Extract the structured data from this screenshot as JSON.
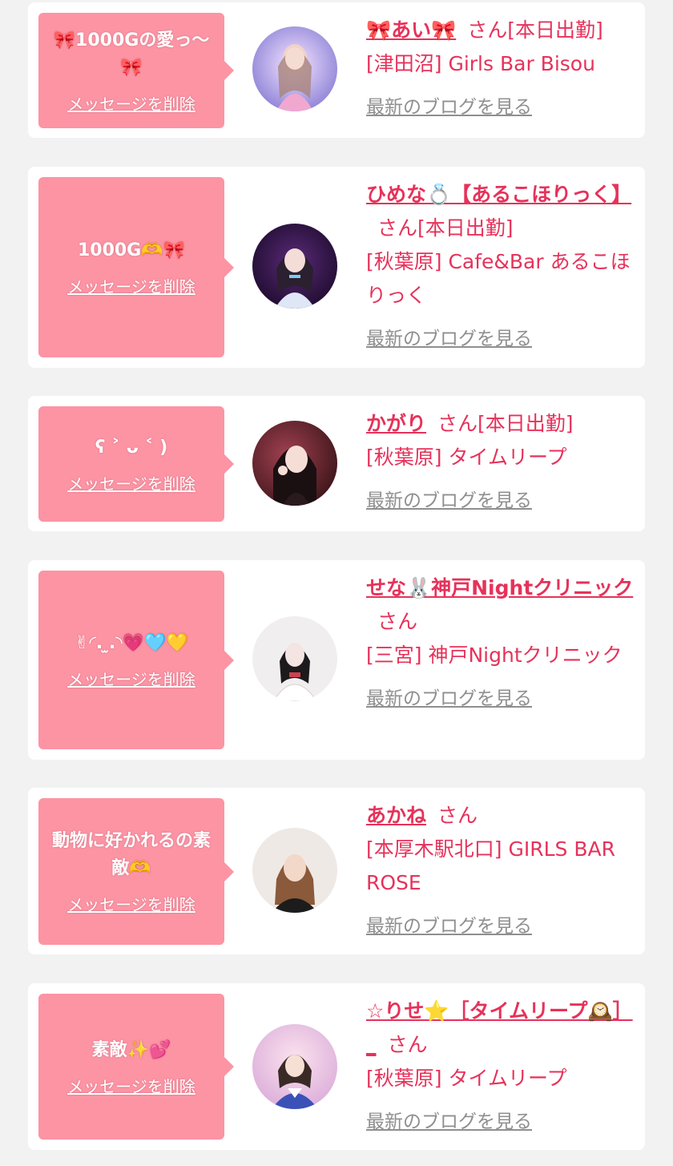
{
  "common": {
    "delete_label": "メッセージを削除",
    "blog_label": "最新のブログを見る",
    "san": "さん"
  },
  "entries": [
    {
      "message": "🎀1000Gの愛っ〜🎀",
      "name": "🎀あい🎀",
      "status": "[本日出勤]",
      "place": "[津田沼] Girls Bar Bisou"
    },
    {
      "message": "1000G🫶🎀",
      "name": "ひめな💍【あるこほりっく】",
      "status": "[本日出勤]",
      "place": "[秋葉原] Cafe&Bar あるこほりっく"
    },
    {
      "message": "ʕ ˃ ᴗ ˂ )",
      "name": "かがり",
      "status": "[本日出勤]",
      "place": "[秋葉原] タイムリープ"
    },
    {
      "message": "✌︎◜. ̫.◝💗🩵💛",
      "name": "せな🐰神戸Nightクリニック",
      "status": "",
      "place": "[三宮] 神戸Nightクリニック"
    },
    {
      "message": "動物に好かれるの素敵🫶",
      "name": "あかね",
      "status": "",
      "place": "[本厚木駅北口] GIRLS BAR ROSE"
    },
    {
      "message": "素敵✨💕",
      "name": "☆りせ⭐️［タイムリープ🕰️］_",
      "status": "",
      "place": "[秋葉原] タイムリープ"
    }
  ]
}
